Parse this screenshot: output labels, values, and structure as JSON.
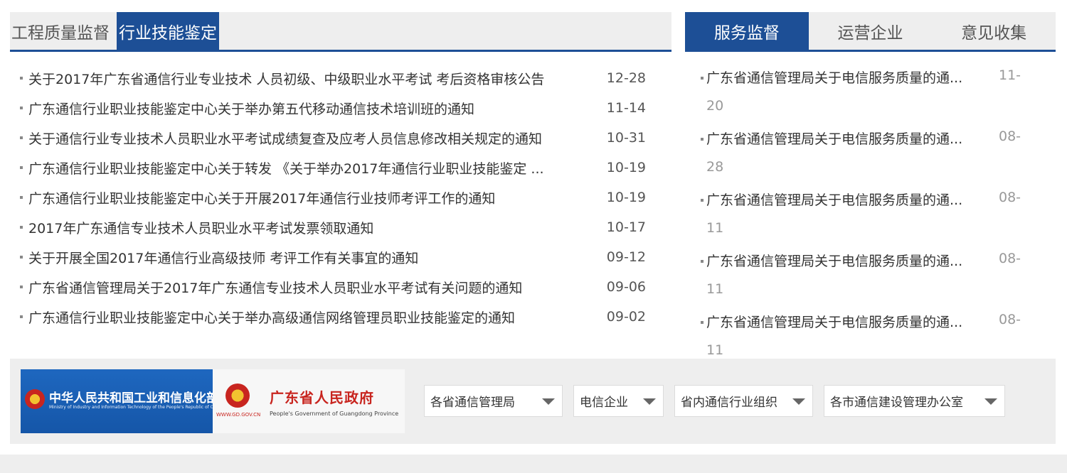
{
  "left": {
    "tabs": [
      {
        "label": "工程质量监督"
      },
      {
        "label": "行业技能鉴定"
      }
    ],
    "items": [
      {
        "title": "关于2017年广东省通信行业专业技术 人员初级、中级职业水平考试 考后资格审核公告",
        "date": "12-28"
      },
      {
        "title": "广东通信行业职业技能鉴定中心关于举办第五代移动通信技术培训班的通知",
        "date": "11-14"
      },
      {
        "title": "关于通信行业专业技术人员职业水平考试成绩复查及应考人员信息修改相关规定的通知",
        "date": "10-31"
      },
      {
        "title": "广东通信行业职业技能鉴定中心关于转发 《关于举办2017年通信行业职业技能鉴定 ...",
        "date": "10-19"
      },
      {
        "title": "广东通信行业职业技能鉴定中心关于开展2017年通信行业技师考评工作的通知",
        "date": "10-19"
      },
      {
        "title": "2017年广东通信专业技术人员职业水平考试发票领取通知",
        "date": "10-17"
      },
      {
        "title": "关于开展全国2017年通信行业高级技师 考评工作有关事宜的通知",
        "date": "09-12"
      },
      {
        "title": "广东省通信管理局关于2017年广东通信专业技术人员职业水平考试有关问题的通知",
        "date": "09-06"
      },
      {
        "title": "广东通信行业职业技能鉴定中心关于举办高级通信网络管理员职业技能鉴定的通知",
        "date": "09-02"
      }
    ]
  },
  "right": {
    "tabs": [
      {
        "label": "服务监督"
      },
      {
        "label": "运营企业"
      },
      {
        "label": "意见收集"
      }
    ],
    "items": [
      {
        "title": "广东省通信管理局关于电信服务质量的通...",
        "date_part1": "11-",
        "date_part2": "20"
      },
      {
        "title": "广东省通信管理局关于电信服务质量的通...",
        "date_part1": "08-",
        "date_part2": "28"
      },
      {
        "title": "广东省通信管理局关于电信服务质量的通...",
        "date_part1": "08-",
        "date_part2": "11"
      },
      {
        "title": "广东省通信管理局关于电信服务质量的通...",
        "date_part1": "08-",
        "date_part2": "11"
      },
      {
        "title": "广东省通信管理局关于电信服务质量的通...",
        "date_part1": "08-",
        "date_part2": "11"
      }
    ]
  },
  "logos": {
    "miit_cn": "中华人民共和国工业和信息化部",
    "miit_en": "Ministry of Industry and Information Technology of the People's Republic of China",
    "gd_url": "WWW.GD.GOV.CN",
    "gd_cn": "广东省人民政府",
    "gd_en": "People's Government of Guangdong Province"
  },
  "selects": [
    {
      "value": "各省通信管理局"
    },
    {
      "value": "电信企业"
    },
    {
      "value": "省内通信行业组织"
    },
    {
      "value": "各市通信建设管理办公室"
    }
  ],
  "colors": {
    "accent": "#1d4f96",
    "tab_bg": "#eeeeee",
    "gov_red": "#c8251f"
  }
}
